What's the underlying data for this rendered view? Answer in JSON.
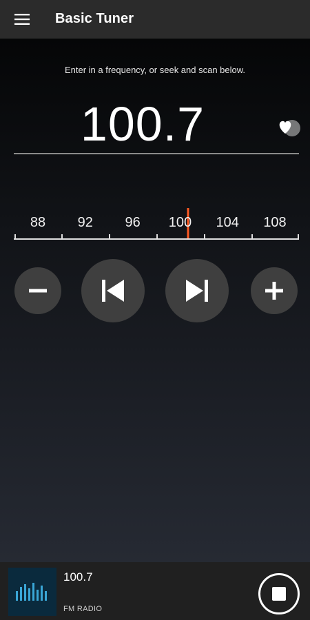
{
  "app_bar": {
    "title": "Basic Tuner",
    "menu_icon": "hamburger-menu-icon"
  },
  "tuner": {
    "hint": "Enter in a frequency, or seek and scan below.",
    "frequency": "100.7",
    "favorite_icon": "heart-icon",
    "dial": {
      "labels": [
        "88",
        "92",
        "96",
        "100",
        "104",
        "108"
      ],
      "range": [
        88,
        108
      ],
      "current": 100.7,
      "needle_color": "#ff5a22"
    },
    "controls": {
      "step_down_icon": "minus-icon",
      "seek_back_icon": "skip-previous-icon",
      "seek_forward_icon": "skip-next-icon",
      "step_up_icon": "plus-icon"
    }
  },
  "now_playing": {
    "title": "100.7",
    "subtitle": "FM RADIO",
    "art_icon": "equalizer-bars-icon",
    "stop_icon": "stop-icon"
  },
  "colors": {
    "app_bar": "#2b2b2b",
    "control_bg": "#3f3f3f",
    "accent": "#ff5a22",
    "player_bg": "#202020"
  }
}
